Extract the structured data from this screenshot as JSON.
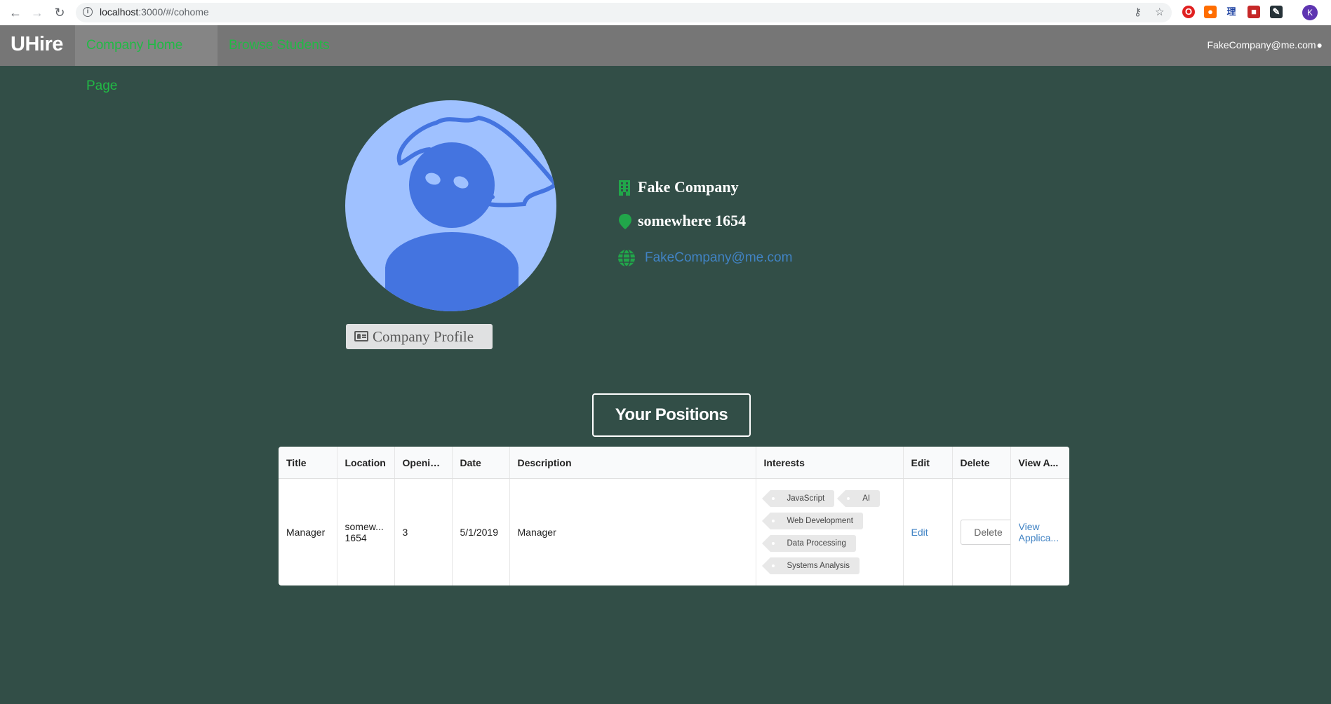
{
  "browser": {
    "url_host": "localhost",
    "url_path": ":3000/#/cohome",
    "profile_initial": "K"
  },
  "navbar": {
    "brand": "UHire",
    "items": [
      {
        "label": "Company Home Page",
        "active": true
      },
      {
        "label": "Browse Students",
        "active": false
      }
    ],
    "user_email": "FakeCompany@me.com"
  },
  "company": {
    "name": "Fake Company",
    "address": "somewhere 1654",
    "email": "FakeCompany@me.com",
    "profile_button": "Company Profile"
  },
  "positions": {
    "header": "Your Positions",
    "columns": [
      "Title",
      "Location",
      "Openin...",
      "Date",
      "Description",
      "Interests",
      "Edit",
      "Delete",
      "View A..."
    ],
    "rows": [
      {
        "title": "Manager",
        "location_line1": "somew...",
        "location_line2": "1654",
        "openings": "3",
        "date": "5/1/2019",
        "description": "Manager",
        "interests": [
          "JavaScript",
          "AI",
          "Web Development",
          "Data Processing",
          "Systems Analysis"
        ],
        "edit": "Edit",
        "delete": "Delete",
        "view_line1": "View",
        "view_line2": "Applica..."
      }
    ]
  },
  "colors": {
    "page_bg": "#324e47",
    "navbar_bg": "#767676",
    "nav_link": "#21ba45",
    "link": "#4183c4",
    "icon_green": "#21a64a",
    "avatar_light": "#9fc1ff",
    "avatar_dark": "#4474e0"
  }
}
